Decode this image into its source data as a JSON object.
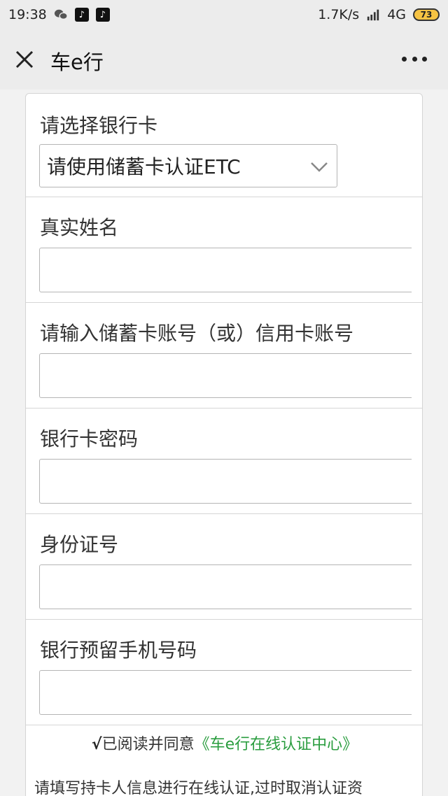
{
  "status_bar": {
    "time": "19:38",
    "network_speed": "1.7K/s",
    "signal_label": "4G",
    "battery": "73",
    "icons": [
      "wechat-icon",
      "tiktok-icon",
      "tiktok-icon",
      "hd-signal-icon",
      "battery-icon"
    ]
  },
  "header": {
    "title": "车e行"
  },
  "form": {
    "bank_card": {
      "label": "请选择银行卡",
      "selected": "请使用储蓄卡认证ETC"
    },
    "real_name": {
      "label": "真实姓名",
      "value": ""
    },
    "card_number": {
      "label": "请输入储蓄卡账号（或）信用卡账号",
      "value": ""
    },
    "card_password": {
      "label": "银行卡密码",
      "value": ""
    },
    "id_number": {
      "label": "身份证号",
      "value": ""
    },
    "phone": {
      "label": "银行预留手机号码",
      "value": ""
    }
  },
  "agreement": {
    "check": "√",
    "prefix": "已阅读并同意",
    "link": "《车e行在线认证中心》"
  },
  "note": "请填写持卡人信息进行在线认证,过时取消认证资",
  "colors": {
    "link_green": "#2a9d3f",
    "header_bg": "#ececec",
    "battery_fill": "#f6c343"
  }
}
